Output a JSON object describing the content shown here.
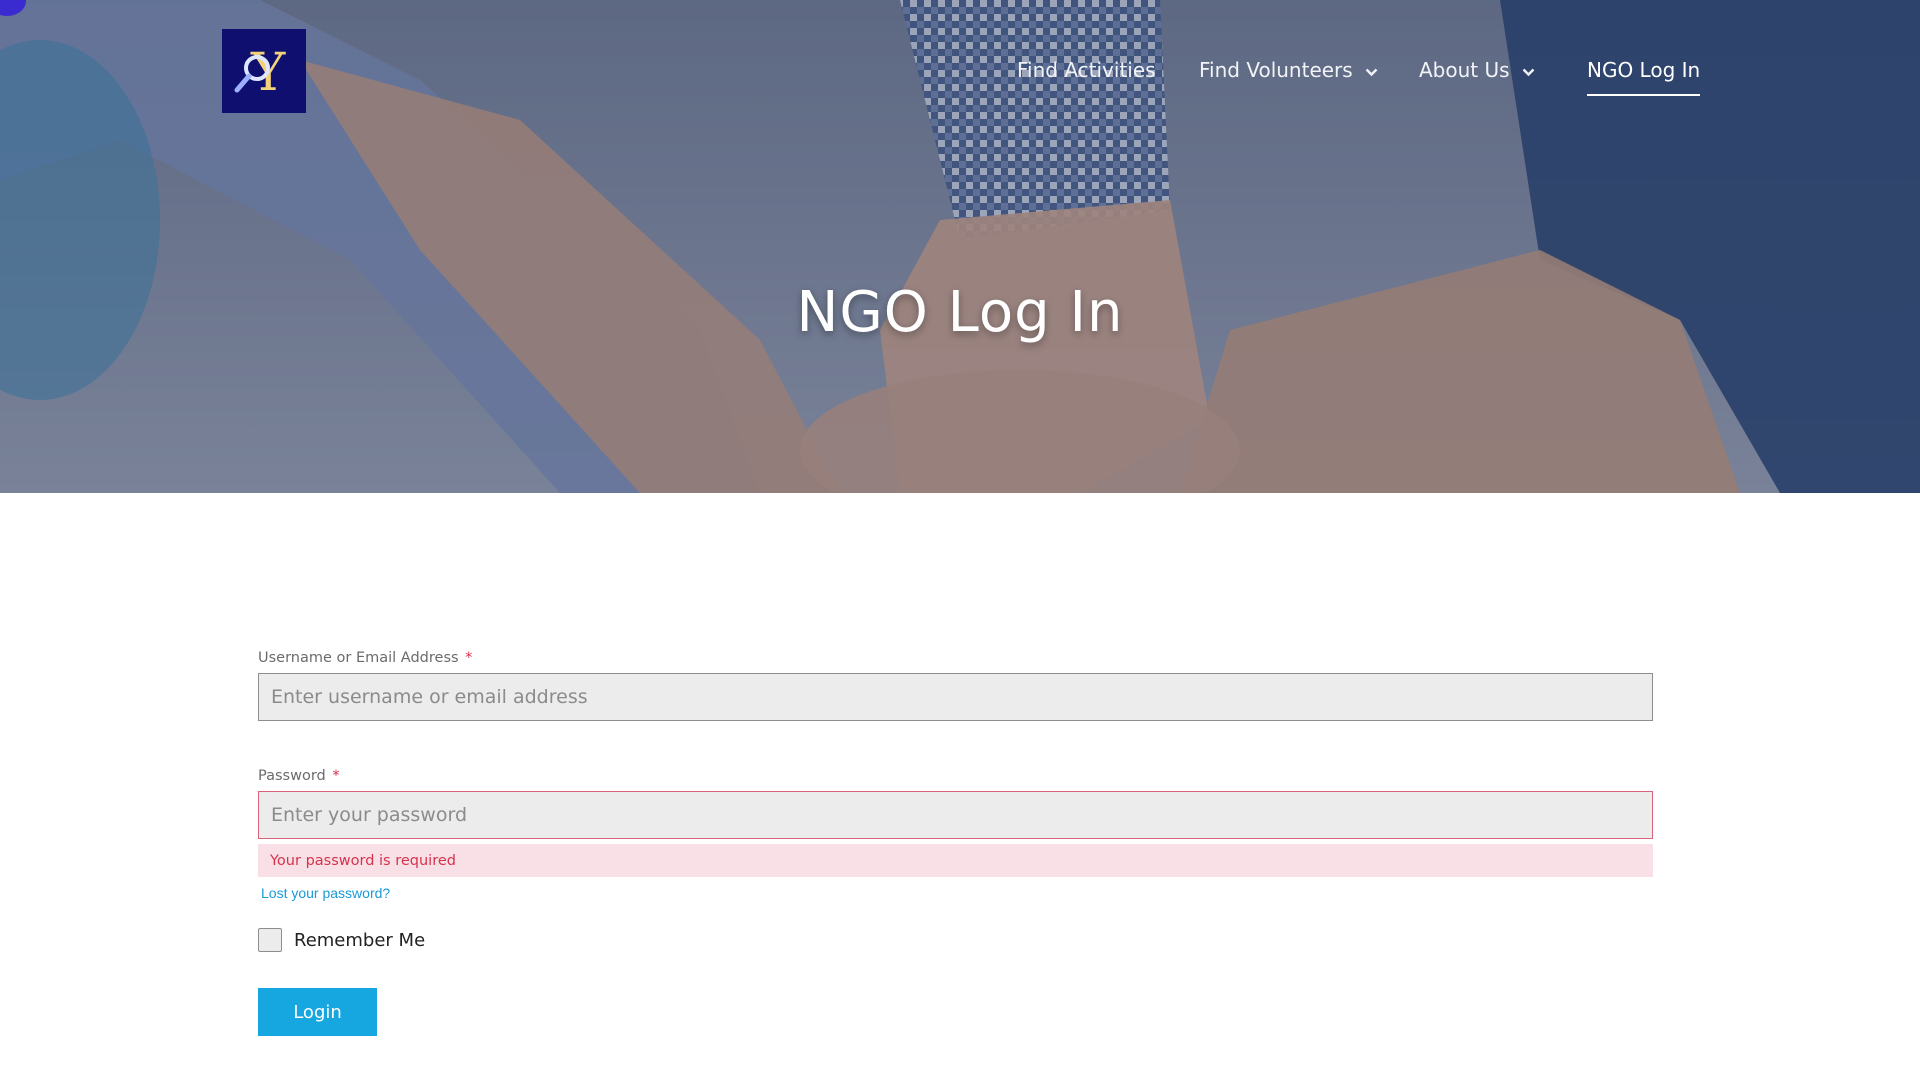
{
  "header": {
    "logo_name": "site-logo",
    "nav": [
      {
        "label": "Find Activities",
        "has_dropdown": false,
        "active": false
      },
      {
        "label": "Find Volunteers",
        "has_dropdown": true,
        "active": false
      },
      {
        "label": "About Us",
        "has_dropdown": true,
        "active": false
      },
      {
        "label": "NGO Log In",
        "has_dropdown": false,
        "active": true
      }
    ]
  },
  "hero": {
    "title": "NGO Log In"
  },
  "form": {
    "username": {
      "label": "Username or Email Address",
      "required_mark": "*",
      "placeholder": "Enter username or email address",
      "value": ""
    },
    "password": {
      "label": "Password",
      "required_mark": "*",
      "placeholder": "Enter your password",
      "value": "",
      "error": "Your password is required"
    },
    "lost_password": "Lost your password?",
    "remember_me": {
      "label": "Remember Me",
      "checked": false
    },
    "submit_label": "Login"
  },
  "colors": {
    "accent": "#16a7e0",
    "error": "#d6324b",
    "error_bg": "#f8e0e6",
    "logo_bg": "#0e0f6e"
  }
}
